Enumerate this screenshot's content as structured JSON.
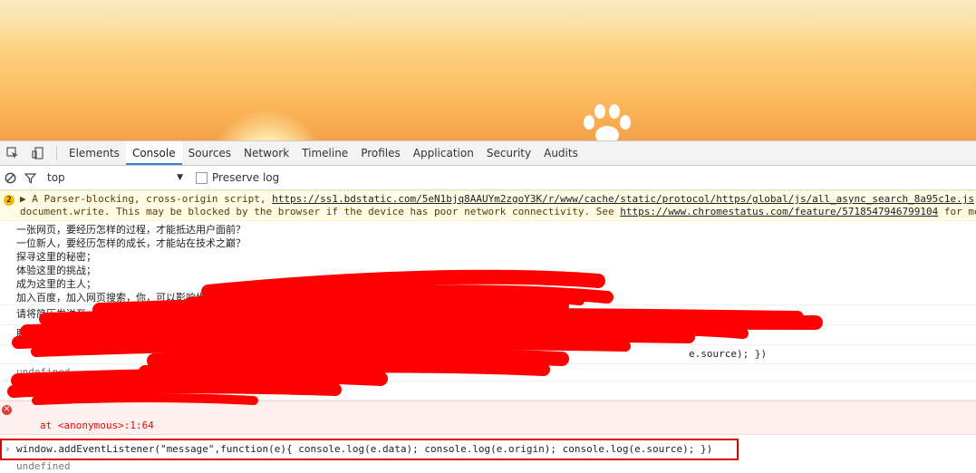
{
  "devtools": {
    "tabs": [
      "Elements",
      "Console",
      "Sources",
      "Network",
      "Timeline",
      "Profiles",
      "Application",
      "Security",
      "Audits"
    ],
    "active_tab": "Console"
  },
  "filter": {
    "context": "top",
    "preserve_log": "Preserve log"
  },
  "console": {
    "warning_count": "2",
    "warning_text_1a": "▶ A Parser-blocking, cross-origin script, ",
    "warning_link_1": "https://ss1.bdstatic.com/5eN1bjq8AAUYm2zgoY3K/r/www/cache/static/protocol/https/global/js/all_async_search_8a95c1e.js",
    "warning_text_1b": ",",
    "warning_text_2a": "document.write. This may be blocked by the browser if the device has poor network connectivity. See ",
    "warning_link_2": "https://www.chromestatus.com/feature/5718547946799104",
    "warning_text_2b": " for mo",
    "log_lines": [
      "一张网页，要经历怎样的过程，才能抵达用户面前？",
      "一位新人，要经历怎样的成长，才能站在技术之巅？",
      "探寻这里的秘密；",
      "体验这里的挑战；",
      "成为这里的主人；",
      "加入百度，加入网页搜索，你，可以影响世界。"
    ],
    "resume_line": "请将简历发送至",
    "job_line": "职位介绍：",
    "partial_source": "e.source); })",
    "undefined_1": "undefined",
    "error_location": "at <anonymous>:1:64",
    "input_command": "window.addEventListener(\"message\",function(e){ console.log(e.data); console.log(e.origin); console.log(e.source); })",
    "undefined_2": "undefined"
  }
}
